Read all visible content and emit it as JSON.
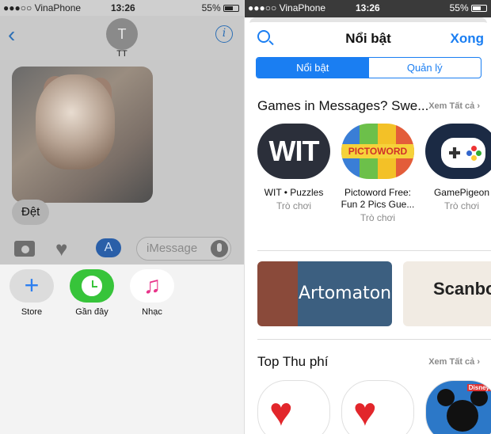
{
  "left": {
    "status": {
      "carrier": "●●●○○ VinaPhone",
      "time": "13:26",
      "battery": "55%"
    },
    "nav": {
      "back_glyph": "‹",
      "avatar_initial": "T",
      "contact_name": "TT",
      "info_glyph": "i"
    },
    "message_bubble": "Đệt",
    "composer": {
      "placeholder": "iMessage"
    },
    "drawer": [
      {
        "label": "Store",
        "glyph": "+"
      },
      {
        "label": "Gần đây"
      },
      {
        "label": "Nhạc",
        "glyph": "♫"
      }
    ]
  },
  "right": {
    "status": {
      "carrier": "●●●○○ VinaPhone",
      "time": "13:26",
      "battery": "55%"
    },
    "header": {
      "title": "Nổi bật",
      "done": "Xong"
    },
    "segments": {
      "featured": "Nổi bật",
      "manage": "Quản lý"
    },
    "games_section": {
      "title": "Games in Messages? Swe...",
      "see_all": "Xem Tất cả ›",
      "items": [
        {
          "name": "WIT • Puzzles",
          "category": "Trò chơi",
          "icon_text": "WIT"
        },
        {
          "name": "Pictoword Free: Fun 2 Pics Gue...",
          "category": "Trò chơi",
          "icon_text": "PICTOWORD"
        },
        {
          "name": "GamePigeon",
          "category": "Trò chơi"
        }
      ]
    },
    "banners": [
      {
        "text": "Artomaton"
      },
      {
        "text": "Scanbo"
      }
    ],
    "paid_section": {
      "title": "Top Thu phí",
      "see_all": "Xem Tất cả ›",
      "disney_badge": "Disney"
    }
  },
  "colors": {
    "ios_blue": "#1a7ef2",
    "recent_green": "#37c43a",
    "music_pink": "#e8348a"
  }
}
